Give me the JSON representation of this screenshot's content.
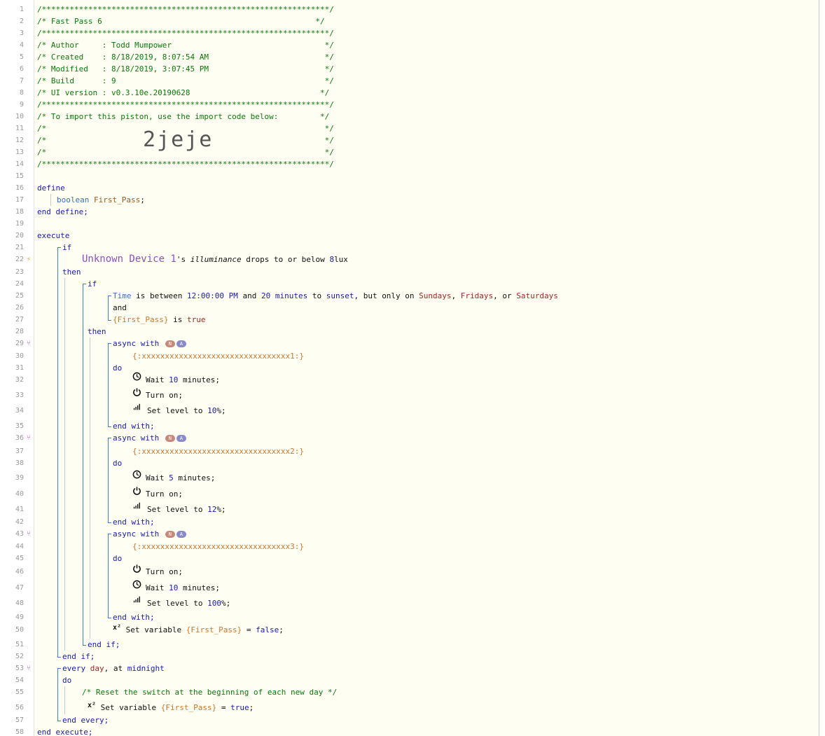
{
  "header_comment": {
    "border": "/**************************************************************/",
    "piston_name": "/* Fast Pass 6                                              */",
    "author": "/* Author     : Todd Mumpower                                 */",
    "created": "/* Created    : 8/18/2019, 8:07:54 AM                         */",
    "modified": "/* Modified   : 8/18/2019, 3:07:45 PM                         */",
    "build": "/* Build      : 9                                             */",
    "ui_version": "/* UI version : v0.3.10e.20190628                            */",
    "import_hint": "/* To import this piston, use the import code below:         */",
    "blank": "/*                                                            */",
    "import_code": "2jeje"
  },
  "define": {
    "open": "define",
    "type": "boolean",
    "var_name": "First_Pass",
    "semicolon": ";",
    "close": "end define;"
  },
  "execute": {
    "open": "execute",
    "if_kw": "if",
    "trigger": {
      "device": "Unknown Device 1",
      "apostrophe": "'s ",
      "attribute": "illuminance",
      "cond_text": " drops to or below ",
      "value": "8",
      "unit": "lux"
    },
    "then_kw": "then",
    "inner_if_kw": "if",
    "time_cond": {
      "time": "Time",
      "between": " is between ",
      "start": "12:00:00 PM",
      "and": " and ",
      "offset_num": "20",
      "offset_unit": " minutes",
      "to": " to ",
      "sunset": "sunset",
      "but_only": ", but only on ",
      "day1": "Sundays",
      "comma": ", ",
      "day2": "Fridays",
      "or": ", or ",
      "day3": "Saturdays"
    },
    "and_kw": "and",
    "bool_cond": {
      "var": "{First_Pass}",
      "is": " is ",
      "val": "true"
    },
    "inner_then_kw": "then",
    "async_label": "async with",
    "badge_n": "N",
    "badge_a": "A",
    "do_kw": "do",
    "end_with": "end with;",
    "groups": [
      {
        "device_token": "{:xxxxxxxxxxxxxxxxxxxxxxxxxxxxxxxx1:}",
        "actions": [
          {
            "icon": "clock-icon",
            "pre": "Wait ",
            "val": "10",
            "post": " minutes;"
          },
          {
            "icon": "power-icon",
            "pre": "Turn on;",
            "val": "",
            "post": ""
          },
          {
            "icon": "signal-bars-icon",
            "pre": "Set level to ",
            "val": "10",
            "post": "%;"
          }
        ]
      },
      {
        "device_token": "{:xxxxxxxxxxxxxxxxxxxxxxxxxxxxxxxx2:}",
        "actions": [
          {
            "icon": "clock-icon",
            "pre": "Wait ",
            "val": "5",
            "post": " minutes;"
          },
          {
            "icon": "power-icon",
            "pre": "Turn on;",
            "val": "",
            "post": ""
          },
          {
            "icon": "signal-bars-icon",
            "pre": "Set level to ",
            "val": "12",
            "post": "%;"
          }
        ]
      },
      {
        "device_token": "{:xxxxxxxxxxxxxxxxxxxxxxxxxxxxxxxx3:}",
        "actions": [
          {
            "icon": "power-icon",
            "pre": "Turn on;",
            "val": "",
            "post": ""
          },
          {
            "icon": "clock-icon",
            "pre": "Wait ",
            "val": "10",
            "post": " minutes;"
          },
          {
            "icon": "signal-bars-icon",
            "pre": "Set level to ",
            "val": "100",
            "post": "%;"
          }
        ]
      }
    ],
    "set_var_1": {
      "label": " Set variable ",
      "var": "{First_Pass}",
      "eq": " = ",
      "val": "false",
      "end": ";"
    },
    "end_if_inner": "end if;",
    "end_if_outer": "end if;",
    "every": {
      "kw": "every ",
      "day": "day",
      "at": ", at ",
      "midnight": "midnight"
    },
    "every_do": "do",
    "reset_comment": "/* Reset the switch at the beginning of each new day */",
    "set_var_2": {
      "label": " Set variable ",
      "var": "{First_Pass}",
      "eq": " = ",
      "val": "true",
      "end": ";"
    },
    "end_every": "end every;",
    "close": "end execute;"
  },
  "line_numbers": [
    "1",
    "2",
    "3",
    "4",
    "5",
    "6",
    "7",
    "8",
    "9",
    "10",
    "11",
    "12",
    "13",
    "14",
    "15",
    "16",
    "17",
    "18",
    "19",
    "20",
    "21",
    "22",
    "23",
    "24",
    "25",
    "26",
    "27",
    "28",
    "29",
    "30",
    "31",
    "32",
    "33",
    "34",
    "35",
    "36",
    "37",
    "38",
    "39",
    "40",
    "41",
    "42",
    "43",
    "44",
    "45",
    "46",
    "47",
    "48",
    "49",
    "50",
    "51",
    "52",
    "53",
    "54",
    "55",
    "56",
    "57",
    "58"
  ],
  "superscript_label": "x²"
}
